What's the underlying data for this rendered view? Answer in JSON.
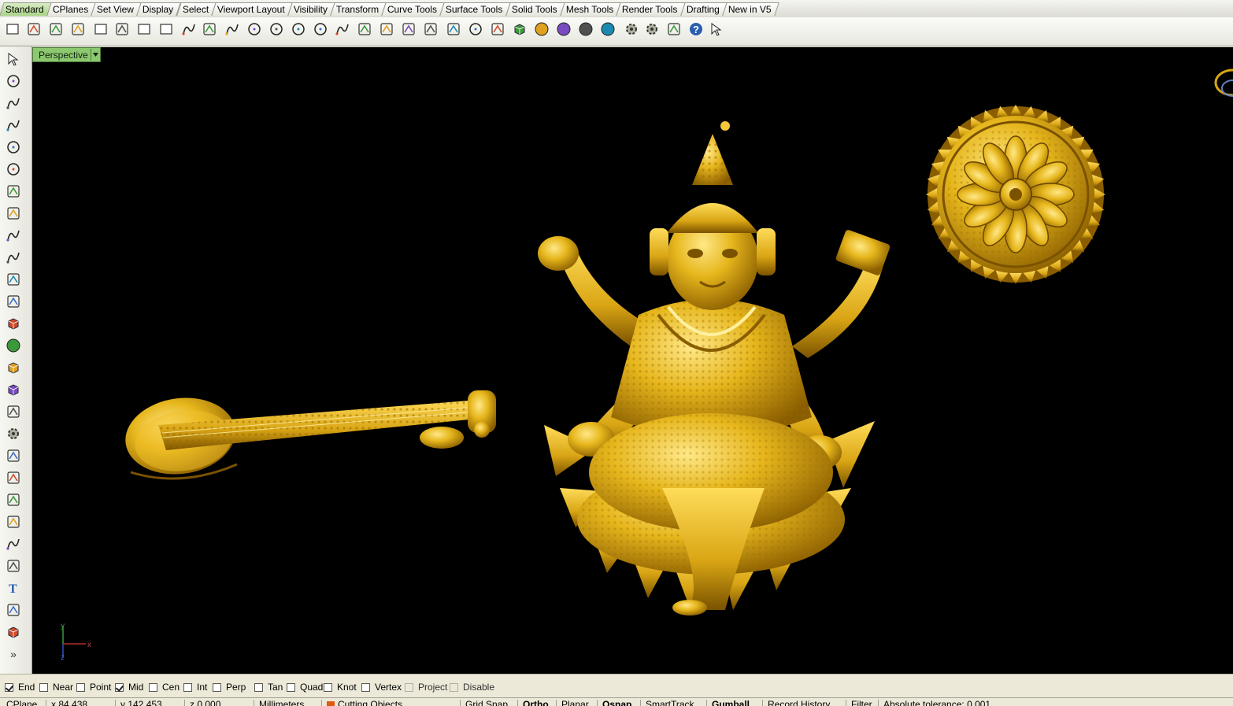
{
  "tabs": [
    {
      "label": "Standard",
      "active": true
    },
    {
      "label": "CPlanes"
    },
    {
      "label": "Set View"
    },
    {
      "label": "Display"
    },
    {
      "label": "Select"
    },
    {
      "label": "Viewport Layout"
    },
    {
      "label": "Visibility"
    },
    {
      "label": "Transform"
    },
    {
      "label": "Curve Tools"
    },
    {
      "label": "Surface Tools"
    },
    {
      "label": "Solid Tools"
    },
    {
      "label": "Mesh Tools"
    },
    {
      "label": "Render Tools"
    },
    {
      "label": "Drafting"
    },
    {
      "label": "New in V5"
    }
  ],
  "toolbar_icons": [
    "new-file-icon",
    "open-file-icon",
    "save-icon",
    "print-icon",
    "import-icon",
    "cut-icon",
    "copy-icon",
    "paste-icon",
    "undo-icon",
    "pan-hand-icon",
    "rotate-view-icon",
    "zoom-icon",
    "zoom-window-icon",
    "zoom-extents-icon",
    "zoom-selected-icon",
    "undo-view-icon",
    "four-viewports-icon",
    "car-icon",
    "camera-icon",
    "cplane-icon",
    "move-icon",
    "light-icon",
    "lock-icon",
    "layer-icon",
    "color-wheel-icon",
    "wireframe-sphere-icon",
    "shaded-sphere-icon",
    "rendered-sphere-icon",
    "tools-icon",
    "options-gear-icon",
    "snap-icon",
    "help-icon",
    "cursor-help-icon"
  ],
  "left_icons": [
    "select-arrow-icon",
    "point-icon",
    "polyline-icon",
    "curve-icon",
    "circle-icon",
    "ellipse-icon",
    "polygon-icon",
    "rectangle-icon",
    "arc-icon",
    "fillet-curve-icon",
    "surface-icon",
    "surface-edit-icon",
    "box-solid-icon",
    "spheres-icon",
    "cylinder-icon",
    "mesh-icon",
    "transform-icon",
    "explode-icon",
    "trim-icon",
    "split-icon",
    "boolean-icon",
    "group-icon",
    "rotate-icon",
    "array-icon",
    "text-icon",
    "dimension-icon",
    "block-icon",
    "more-icon"
  ],
  "viewport": {
    "label": "Perspective",
    "axis_y": "y",
    "axis_x": "x",
    "axis_z": "z"
  },
  "osnaps": [
    {
      "label": "End",
      "checked": true
    },
    {
      "label": "Near",
      "checked": false
    },
    {
      "label": "Point",
      "checked": false
    },
    {
      "label": "Mid",
      "checked": true
    },
    {
      "label": "Cen",
      "checked": false
    },
    {
      "label": "Int",
      "checked": false
    },
    {
      "label": "Perp",
      "checked": false
    },
    {
      "label": "Tan",
      "checked": false
    },
    {
      "label": "Quad",
      "checked": false
    },
    {
      "label": "Knot",
      "checked": false
    },
    {
      "label": "Vertex",
      "checked": false
    },
    {
      "label": "Project",
      "checked": false,
      "disabled": true
    },
    {
      "label": "Disable",
      "checked": false,
      "disabled": true
    }
  ],
  "status": {
    "cplane": "CPlane",
    "x": "x 84.438",
    "y": "y 142.453",
    "z": "z 0.000",
    "units": "Millimeters",
    "layer": "Cutting Objects",
    "grid_snap": "Grid Snap",
    "ortho": "Ortho",
    "planar": "Planar",
    "osnap": "Osnap",
    "smarttrack": "SmartTrack",
    "gumball": "Gumball",
    "record_history": "Record History",
    "filter": "Filter",
    "tolerance": "Absolute tolerance: 0.001"
  },
  "colors": {
    "gold": "#e2b21a",
    "gold_dark": "#8a5e00",
    "gold_light": "#ffe27a",
    "active_tab": "#a9d487",
    "viewport_label": "#8cc86f",
    "layer_swatch": "#e05a10"
  }
}
